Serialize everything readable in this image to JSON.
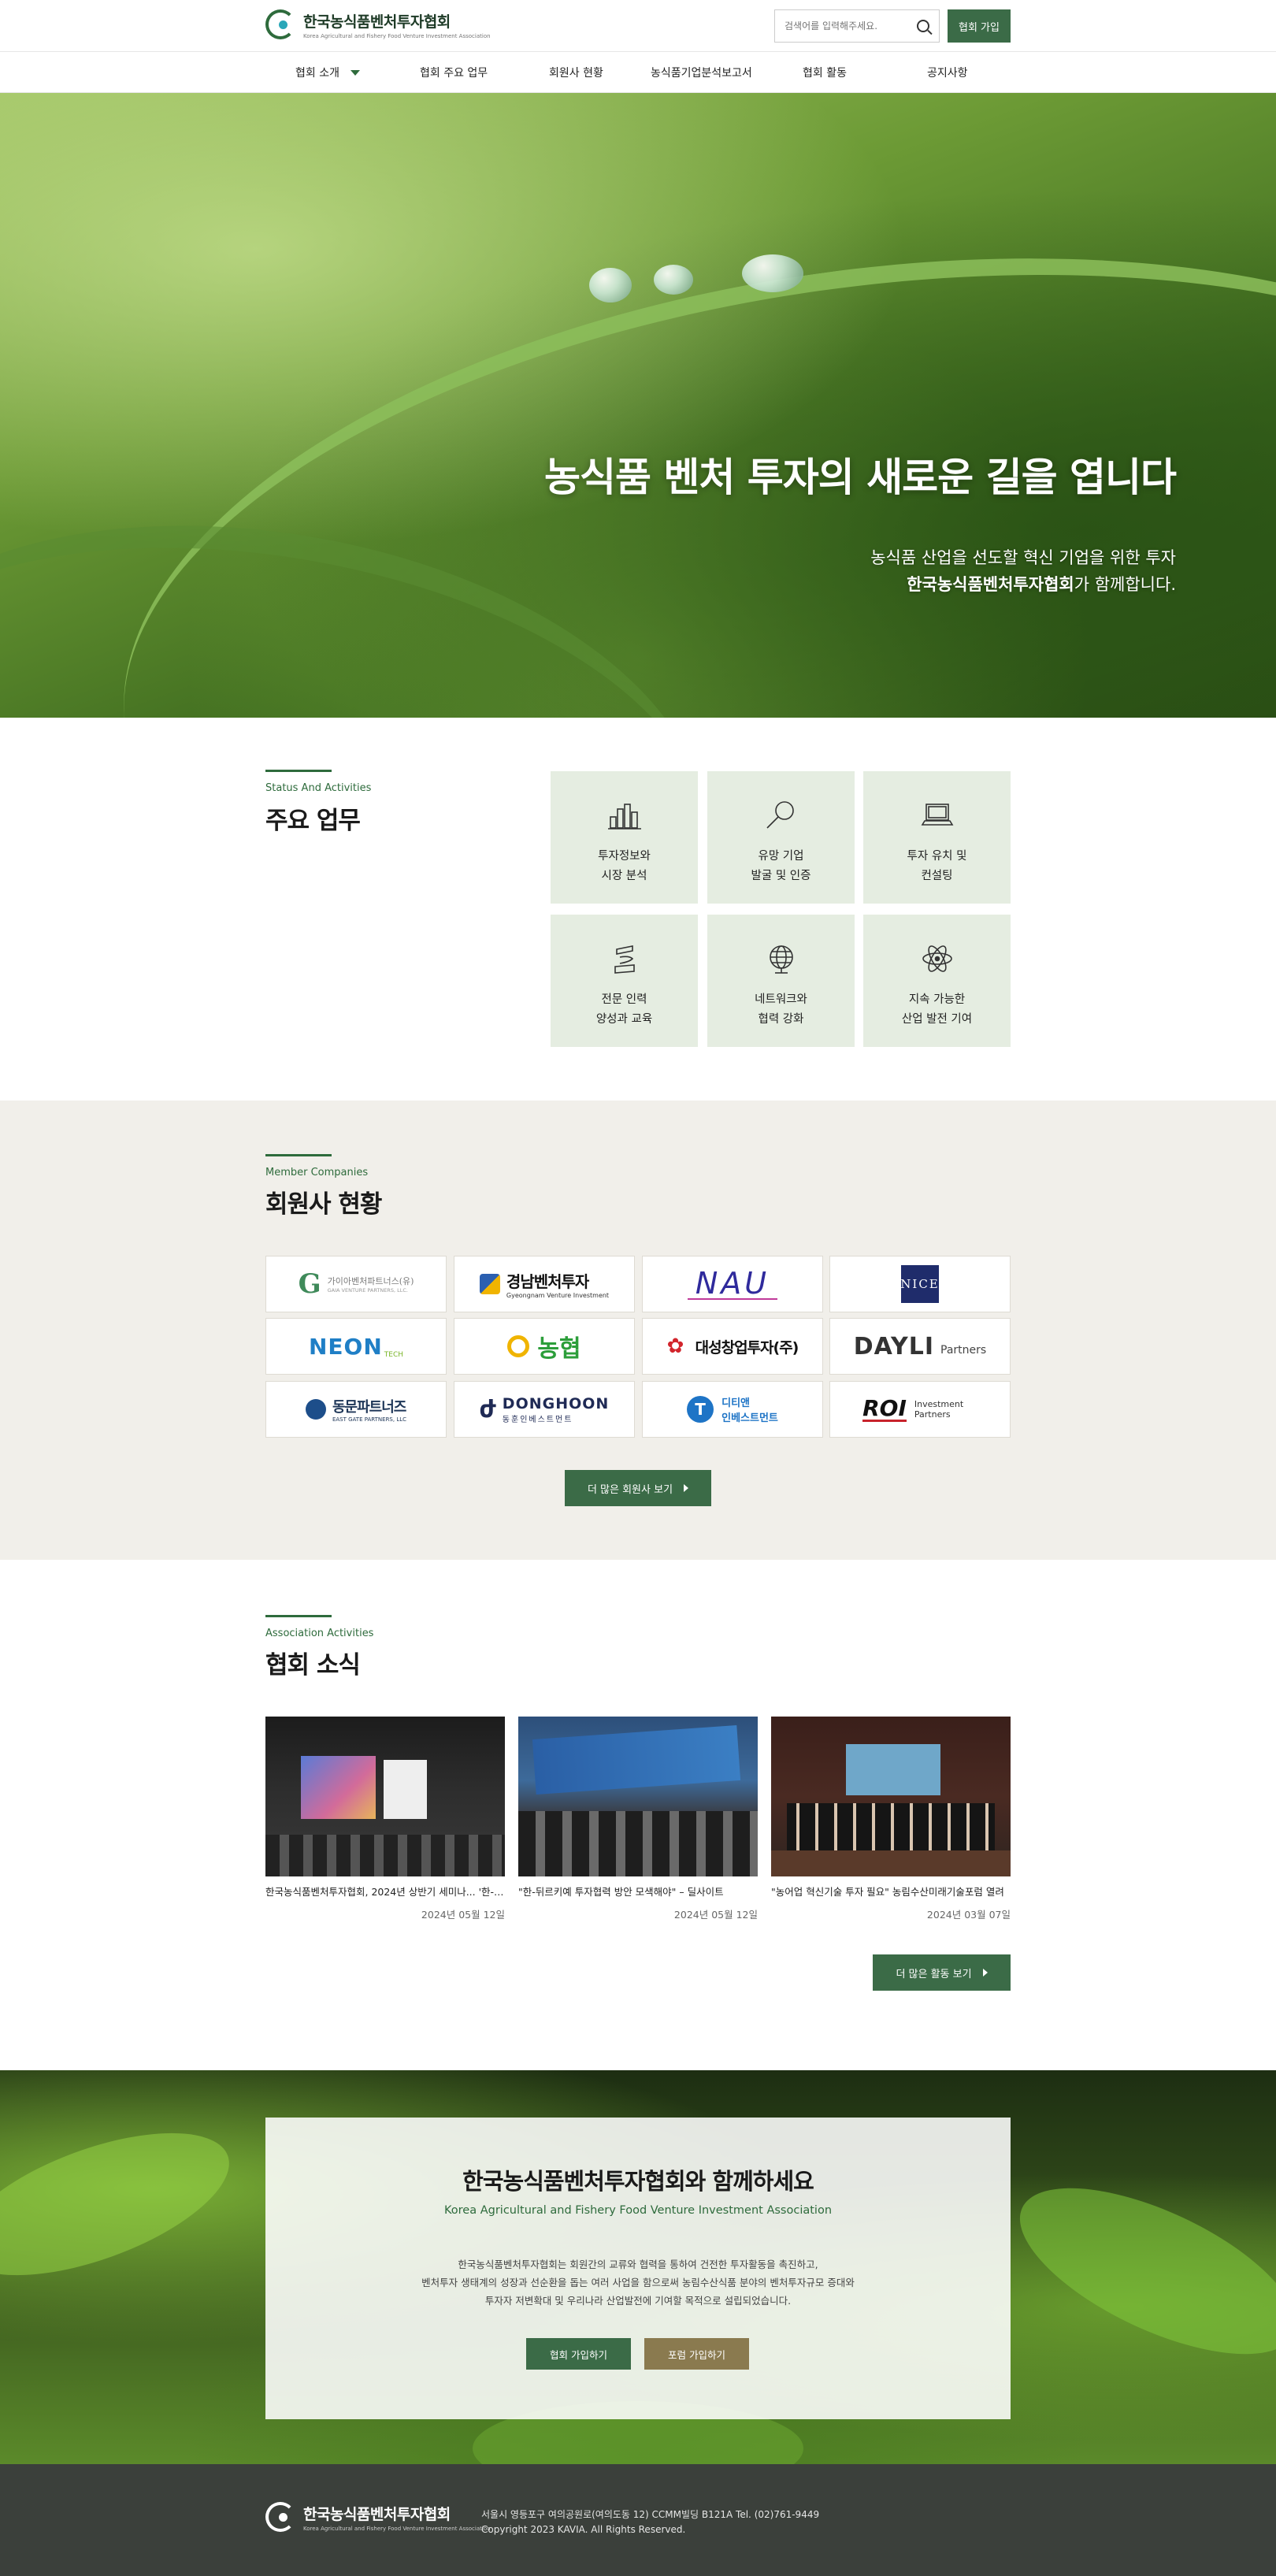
{
  "header": {
    "logo_title": "한국농식품벤처투자협회",
    "logo_sub": "Korea Agricultural and Fishery Food Venture Investment Association",
    "search_placeholder": "검색어를 입력해주세요.",
    "join_label": "협회 가입"
  },
  "nav": {
    "items": [
      {
        "label": "협회 소개"
      },
      {
        "label": "협회 주요 업무"
      },
      {
        "label": "회원사 현황"
      },
      {
        "label": "농식품기업분석보고서"
      },
      {
        "label": "협회 활동"
      },
      {
        "label": "공지사항"
      }
    ]
  },
  "hero": {
    "title": "농식품 벤처 투자의 새로운 길을 엽니다",
    "line1": "농식품 산업을 선도할 혁신 기업을 위한 투자",
    "line2_bold": "한국농식품벤처투자협회",
    "line2_rest": "가 함께합니다."
  },
  "business": {
    "eyebrow": "Status And Activities",
    "title": "주요 업무",
    "cards": [
      {
        "icon": "bar-chart-icon",
        "line1": "투자정보와",
        "line2": "시장 분석"
      },
      {
        "icon": "magnifier-icon",
        "line1": "유망 기업",
        "line2": "발굴 및 인증"
      },
      {
        "icon": "laptop-icon",
        "line1": "투자 유치 및",
        "line2": "컨설팅"
      },
      {
        "icon": "hat-icon",
        "line1": "전문 인력",
        "line2": "양성과 교육"
      },
      {
        "icon": "globe-icon",
        "line1": "네트워크와",
        "line2": "협력 강화"
      },
      {
        "icon": "atom-icon",
        "line1": "지속 가능한",
        "line2": "산업 발전 기여"
      }
    ]
  },
  "members": {
    "eyebrow": "Member Companies",
    "title": "회원사 현황",
    "logos": [
      {
        "name": "가이아벤처파트너스(유)",
        "sub": "GAIA VENTURE PARTNERS, LLC."
      },
      {
        "name": "경남벤처투자",
        "sub": "Gyeongnam Venture Investment"
      },
      {
        "name": "NAU",
        "sub": ""
      },
      {
        "name": "NICE",
        "sub": ""
      },
      {
        "name": "NEON",
        "sub": "TECH"
      },
      {
        "name": "농협",
        "sub": ""
      },
      {
        "name": "대성창업투자(주)",
        "sub": ""
      },
      {
        "name": "DAYLI",
        "sub": "Partners"
      },
      {
        "name": "동문파트너즈",
        "sub": "EAST GATE PARTNERS, LLC"
      },
      {
        "name": "DONGHOON",
        "sub": "동훈인베스트먼트"
      },
      {
        "name": "디티앤",
        "sub": "인베스트먼트"
      },
      {
        "name": "ROI",
        "sub": "Investment Partners"
      }
    ],
    "more_label": "더 많은 회원사 보기"
  },
  "news": {
    "eyebrow": "Association Activities",
    "title": "협회 소식",
    "items": [
      {
        "title": "한국농식품벤처투자협회, 2024년 상반기 세미나... '한-뒤...",
        "date": "2024년 05월 12일"
      },
      {
        "title": "\"한-뒤르키예 투자협력 방안 모색해야\" – 딜사이트",
        "date": "2024년 05월 12일"
      },
      {
        "title": "\"농어업 혁신기술 투자 필요\" 농림수산미래기술포럼 열려",
        "date": "2024년 03월 07일"
      }
    ],
    "more_label": "더 많은 활동 보기"
  },
  "cta": {
    "title": "한국농식품벤처투자협회와 함께하세요",
    "subtitle": "Korea Agricultural and Fishery Food Venture Investment Association",
    "p1": "한국농식품벤처투자협회는 회원간의 교류와 협력을 통하여 건전한 투자활동을 촉진하고,",
    "p2": "벤처투자 생태계의 성장과 선순환을 돕는 여러 사업을 함으로써 농림수산식품 분야의 벤처투자규모 증대와",
    "p3": "투자자 저변확대 및 우리나라 산업발전에 기여할 목적으로 설립되었습니다.",
    "btn1": "협회 가입하기",
    "btn2": "포럼 가입하기"
  },
  "footer": {
    "logo_title": "한국농식품벤처투자협회",
    "logo_sub": "Korea Agricultural and Fishery Food Venture Investment Association",
    "address": "서울시 영등포구 여의공원로(여의도동 12) CCMM빌딩 B121A Tel. (02)761-9449",
    "copyright": "Copyright 2023  KAVIA. All Rights Reserved."
  },
  "colors": {
    "brand_green": "#3b6b47",
    "accent_green": "#2e6b3c",
    "card_bg": "#e5ede1",
    "members_bg": "#f1efea",
    "forum_btn": "#8a7a4f",
    "footer_bg": "#3b403b"
  }
}
